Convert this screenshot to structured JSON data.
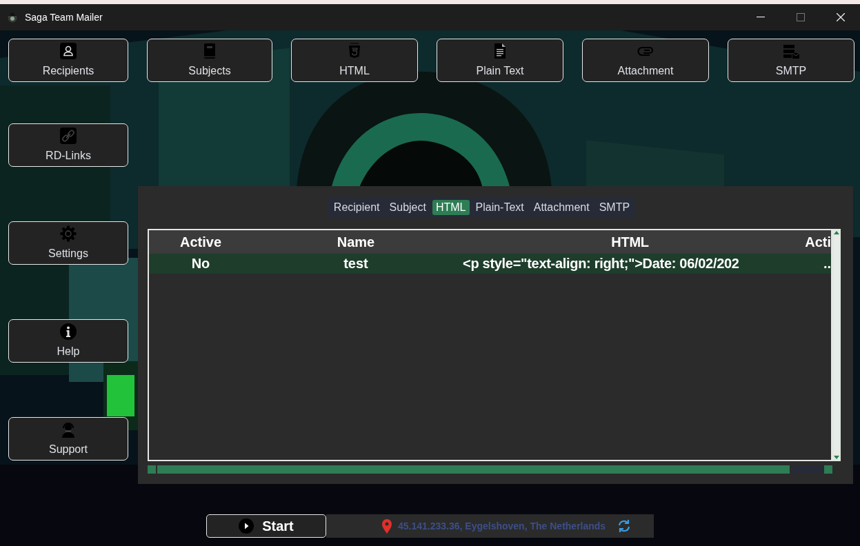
{
  "window": {
    "title": "Saga Team Mailer"
  },
  "toolbar": [
    {
      "label": "Recipients",
      "kind": "person"
    },
    {
      "label": "Subjects",
      "kind": "book"
    },
    {
      "label": "HTML",
      "kind": "html"
    },
    {
      "label": "Plain Text",
      "kind": "document"
    },
    {
      "label": "Attachment",
      "kind": "paperclip"
    },
    {
      "label": "SMTP",
      "kind": "server"
    }
  ],
  "sidebar": [
    {
      "label": "RD-Links",
      "kind": "link"
    },
    {
      "label": "Settings",
      "kind": "gear"
    },
    {
      "label": "Help",
      "kind": "info"
    },
    {
      "label": "Support",
      "kind": "headset"
    }
  ],
  "tabs": [
    {
      "label": "Recipient",
      "selected": false
    },
    {
      "label": "Subject",
      "selected": false
    },
    {
      "label": "HTML",
      "selected": true
    },
    {
      "label": "Plain-Text",
      "selected": false
    },
    {
      "label": "Attachment",
      "selected": false
    },
    {
      "label": "SMTP",
      "selected": false
    }
  ],
  "table": {
    "columns": [
      "Active",
      "Name",
      "HTML",
      "Acti"
    ],
    "rows": [
      {
        "cells": [
          "No",
          "test",
          "<p style=\"text-align: right;\">Date: 06/02/202",
          ".."
        ],
        "selected": true
      }
    ]
  },
  "start_button": {
    "label": "Start"
  },
  "status": {
    "location": "45.141.233.36, Eygelshoven, The Netherlands"
  }
}
